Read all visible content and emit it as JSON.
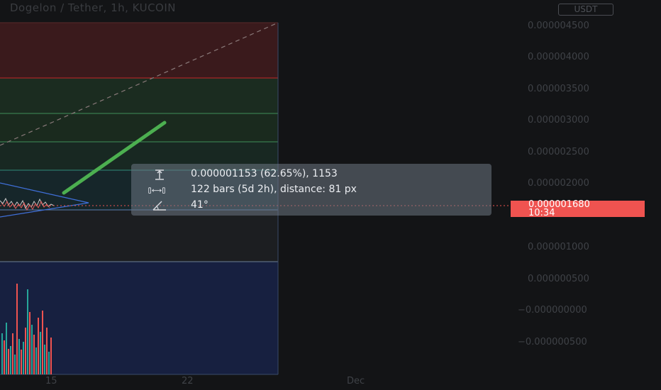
{
  "header": {
    "symbol_title": "Dogelon / Tether, 1h, KUCOIN",
    "currency_badge": "USDT"
  },
  "price_axis": {
    "labels": [
      "0.000004500",
      "0.000004000",
      "0.000003500",
      "0.000003000",
      "0.000002500",
      "0.000002000",
      "0.000001000",
      "0.000000500",
      "−0.000000000",
      "−0.000000500"
    ]
  },
  "time_axis": {
    "labels": [
      "15",
      "22",
      "Dec"
    ]
  },
  "last_price": {
    "value": "0.000001680",
    "countdown": "10:34",
    "color": "#ef5350"
  },
  "measure_tooltip": {
    "price_change": "0.000001153 (62.65%), 1153",
    "bar_range": "122 bars (5d 2h), distance: 81 px",
    "angle": "41°"
  },
  "colors": {
    "background": "#131416",
    "red_zone": "#3a1a1c",
    "green_zone": "#1a2a1e",
    "blue_zone": "#172040",
    "trend_arrow": "#4caf50"
  }
}
